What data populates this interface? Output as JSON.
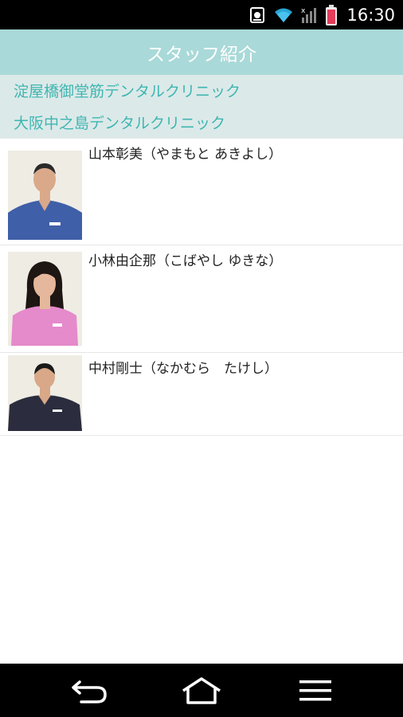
{
  "status_bar": {
    "time": "16:30",
    "icons": [
      "notification-icon",
      "wifi-icon",
      "signal-icon",
      "battery-icon"
    ]
  },
  "header": {
    "title": "スタッフ紹介"
  },
  "clinics": [
    {
      "label": "淀屋橋御堂筋デンタルクリニック"
    },
    {
      "label": "大阪中之島デンタルクリニック"
    }
  ],
  "staff": [
    {
      "name": "山本彰美（やまもと あきよし）",
      "scrub_color": "#3f5fa8"
    },
    {
      "name": "小林由企那（こばやし ゆきな）",
      "scrub_color": "#e58acb"
    },
    {
      "name": "中村剛士（なかむら　たけし）",
      "scrub_color": "#2b2d3e"
    }
  ],
  "colors": {
    "header_bg": "#a9d9d8",
    "clinic_bg": "#dce9e9",
    "clinic_text": "#3fb6b0"
  },
  "nav": [
    "back-icon",
    "home-icon",
    "menu-icon"
  ]
}
